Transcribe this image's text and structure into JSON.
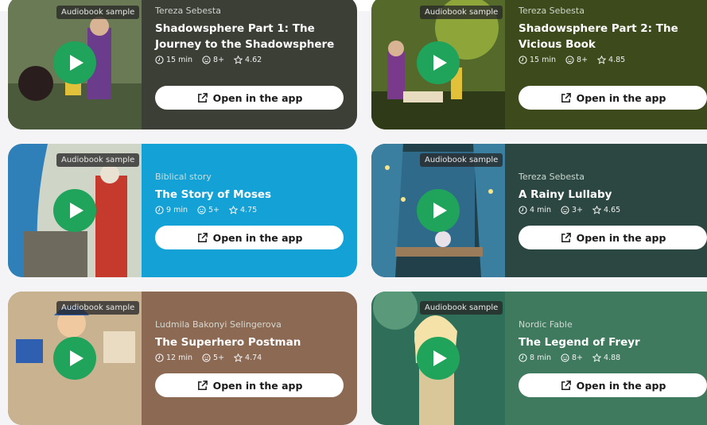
{
  "badge_label": "Audiobook sample",
  "open_label": "Open in the app",
  "cards": [
    {
      "author": "Tereza Sebesta",
      "title": "Shadowsphere Part 1: The Journey to the Shadowsphere",
      "duration": "15 min",
      "age": "8+",
      "rating": "4.62",
      "bg": "#3b3f36"
    },
    {
      "author": "Tereza Sebesta",
      "title": "Shadowsphere Part 2: The Vicious Book",
      "duration": "15 min",
      "age": "8+",
      "rating": "4.85",
      "bg": "#3d4a1b"
    },
    {
      "author": "Biblical story",
      "title": "The Story of Moses",
      "duration": "9 min",
      "age": "5+",
      "rating": "4.75",
      "bg": "#14a2d6"
    },
    {
      "author": "Tereza Sebesta",
      "title": "A Rainy Lullaby",
      "duration": "4 min",
      "age": "3+",
      "rating": "4.65",
      "bg": "#2c4741"
    },
    {
      "author": "Ludmila Bakonyi Selingerova",
      "title": "The Superhero Postman",
      "duration": "12 min",
      "age": "5+",
      "rating": "4.74",
      "bg": "#8c6953"
    },
    {
      "author": "Nordic Fable",
      "title": "The Legend of Freyr",
      "duration": "8 min",
      "age": "8+",
      "rating": "4.88",
      "bg": "#3f7a5e"
    }
  ]
}
